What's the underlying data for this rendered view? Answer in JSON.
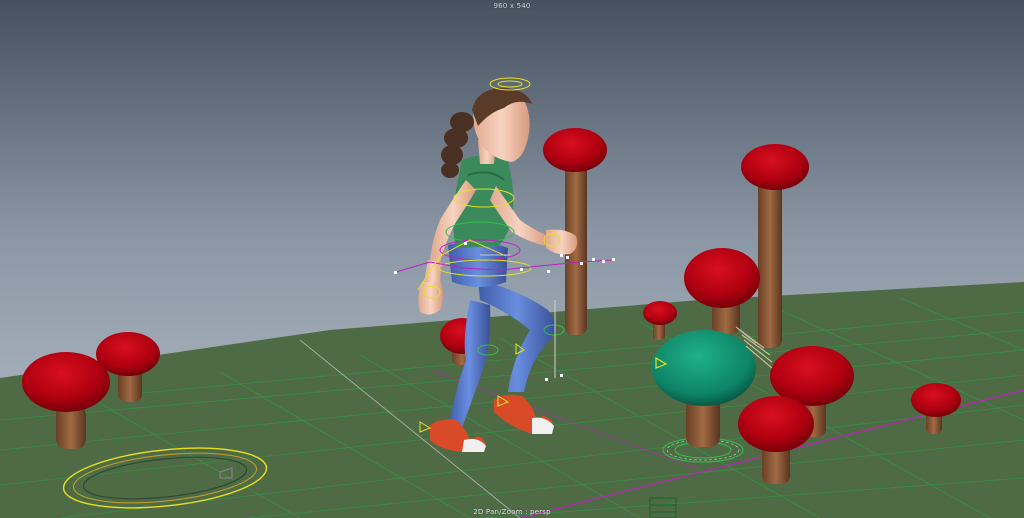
{
  "viewport": {
    "resolution_label": "960 x 540",
    "camera_label": "2D Pan/Zoom : persp",
    "panel_type": "perspective-viewport"
  },
  "colors": {
    "sky_top": "#4a5564",
    "sky_bottom": "#b8c2cc",
    "ground": "#4e6a45",
    "grid_line": "#2fa84a",
    "mushroom_cap": "#b80012",
    "mushroom_stem": "#8a5a3a",
    "selected_cap": "#0f8a6a",
    "shirt": "#3a8a5c",
    "jeans": "#5a7ed0",
    "shoes": "#d84a28",
    "skin": "#f0c8b0",
    "hair": "#5a3a28",
    "control_yellow": "#e8e020",
    "control_magenta": "#c020c0"
  },
  "scene": {
    "character": "female-character-rig",
    "objects": [
      "mushroom",
      "mushroom",
      "mushroom",
      "mushroom",
      "mushroom",
      "mushroom",
      "mushroom",
      "mushroom",
      "mushroom",
      "mushroom",
      "mushroom",
      "mushroom"
    ],
    "selected_object": "mushroom"
  }
}
